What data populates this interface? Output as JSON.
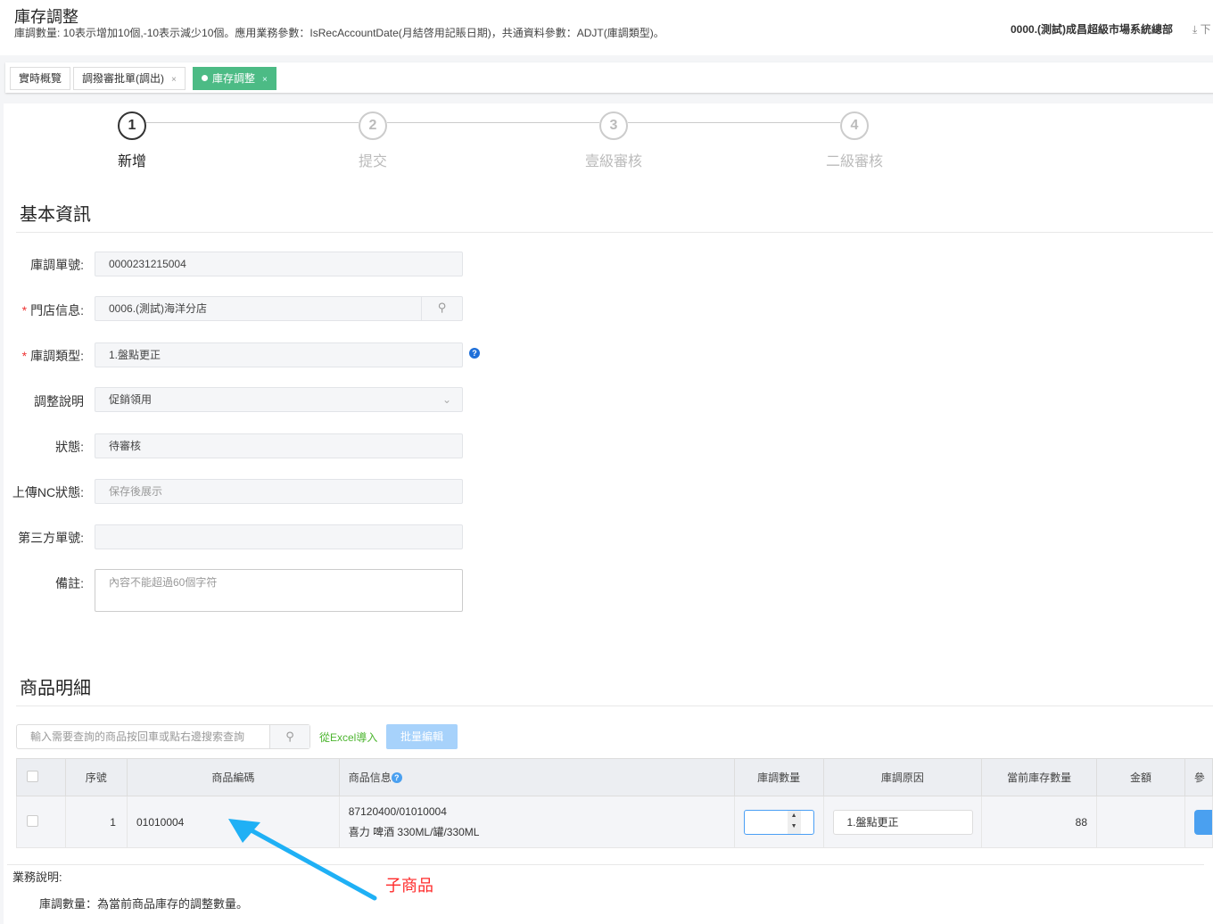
{
  "header": {
    "title": "庫存調整",
    "subtitle": "庫調數量: 10表示增加10個,-10表示減少10個。應用業務參數：IsRecAccountDate(月結啓用記賬日期)，共通資料參數：ADJT(庫調類型)。",
    "org": "0000.(測試)成昌超級市場系統總部",
    "download": "下"
  },
  "tabs": [
    {
      "label": "實時概覽"
    },
    {
      "label": "調撥審批單(調出)",
      "close": "×"
    },
    {
      "label": "庫存調整",
      "close": "×"
    }
  ],
  "steps": [
    {
      "num": "1",
      "label": "新增"
    },
    {
      "num": "2",
      "label": "提交"
    },
    {
      "num": "3",
      "label": "壹級審核"
    },
    {
      "num": "4",
      "label": "二級審核"
    }
  ],
  "basic": {
    "title": "基本資訊",
    "req": "*",
    "fields": [
      {
        "label": "庫調單號:",
        "value": "0000231215004"
      },
      {
        "label": "門店信息:",
        "value": "0006.(測試)海洋分店"
      },
      {
        "label": "庫調類型:",
        "value": "1.盤點更正",
        "help": "?"
      },
      {
        "label": "調整說明",
        "value": "促銷領用"
      },
      {
        "label": "狀態:",
        "value": "待審核"
      },
      {
        "label": "上傳NC狀態:",
        "placeholder": "保存後展示"
      },
      {
        "label": "第三方單號:",
        "value": ""
      },
      {
        "label": "備註:",
        "placeholder": "內容不能超過60個字符"
      }
    ]
  },
  "detail": {
    "title": "商品明細",
    "search_placeholder": "輸入需要查詢的商品按回車或點右邊搜索查詢",
    "import": "從Excel導入",
    "batch_edit": "批量編輯",
    "columns": [
      "序號",
      "商品編碼",
      "商品信息",
      "庫調數量",
      "庫調原因",
      "當前庫存數量",
      "金額",
      "參"
    ],
    "rows": [
      {
        "seq": "1",
        "code": "01010004",
        "info1": "87120400/01010004",
        "info2": "喜力 啤酒 330ML/罐/330ML",
        "qty": "",
        "reason": "1.盤點更正",
        "stock": "88",
        "amount": ""
      }
    ]
  },
  "notes": {
    "title": "業務說明:",
    "line1": "庫調數量：為當前商品庫存的調整數量。"
  },
  "annotation": {
    "text": "子商品",
    "color": "#ff2a2a",
    "arrow_color": "#1fb0f5"
  }
}
